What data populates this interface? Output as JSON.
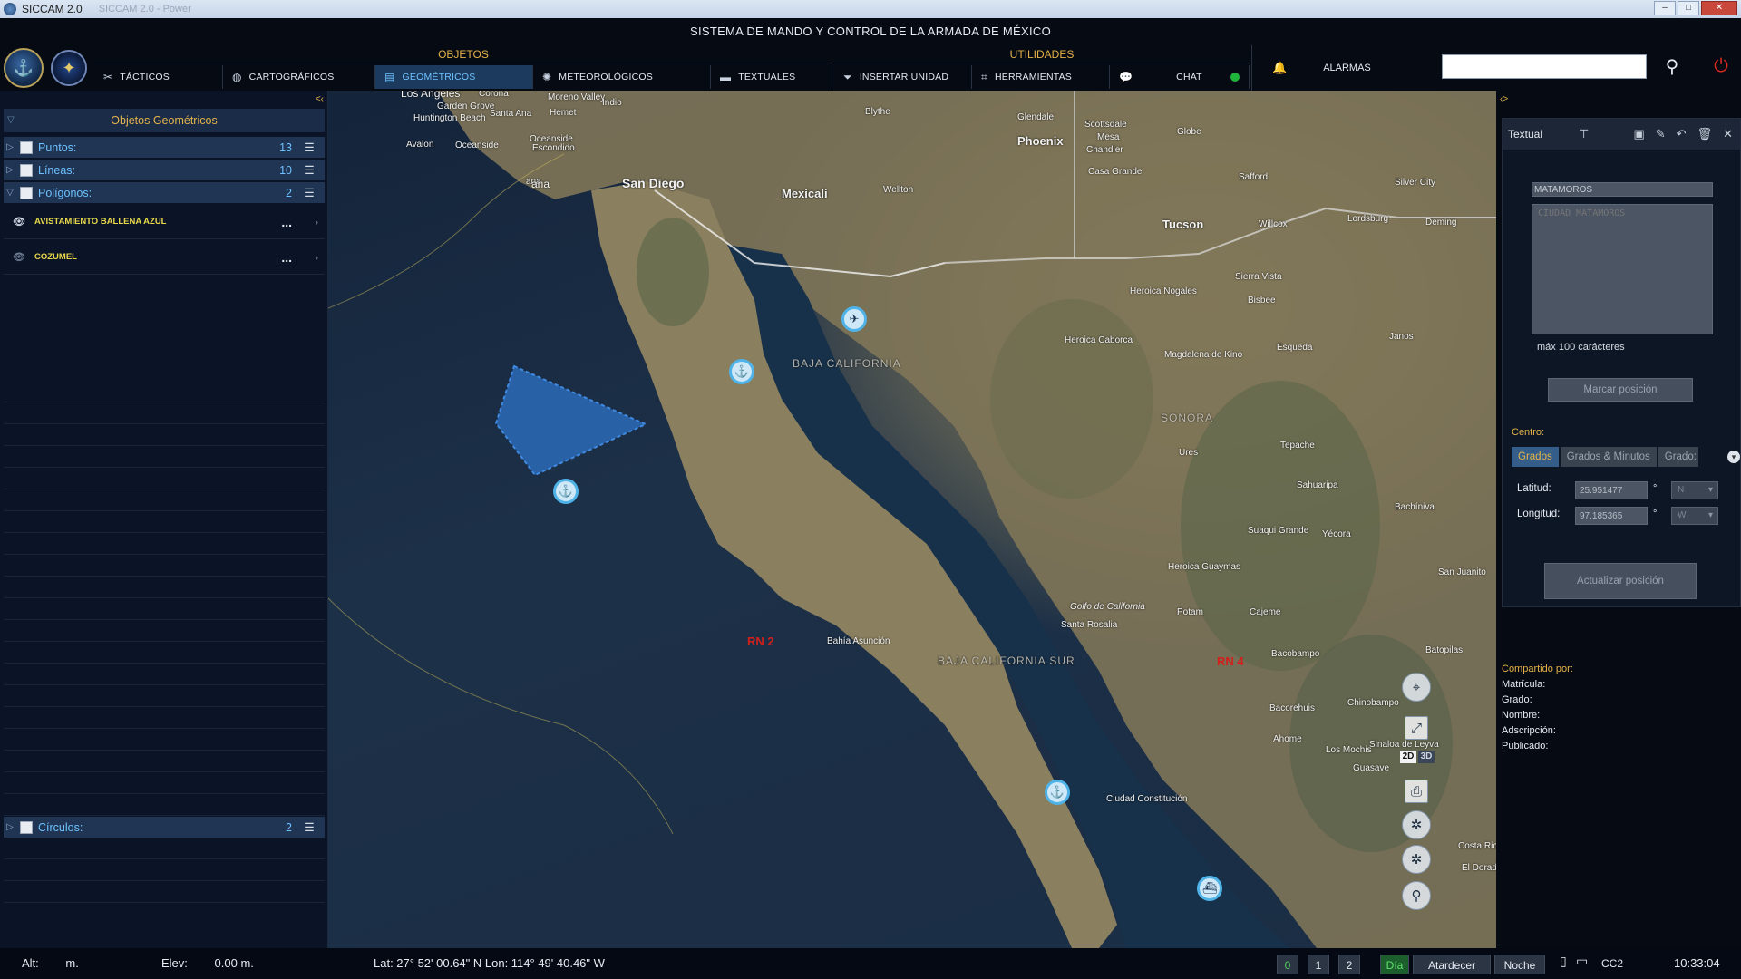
{
  "window": {
    "title": "SICCAM 2.0",
    "blurred_title": "SICCAM 2.0 - Power"
  },
  "header": {
    "system_title": "SISTEMA DE MANDO Y CONTROL DE LA ARMADA DE MÉXICO",
    "group_objetos": "OBJETOS",
    "group_utilidades": "UTILIDADES",
    "menu": {
      "tacticos": "TÁCTICOS",
      "cartograficos": "CARTOGRÁFICOS",
      "geometricos": "GEOMÉTRICOS",
      "meteorologicos": "METEOROLÓGICOS",
      "textuales": "TEXTUALES",
      "insertar_unidad": "INSERTAR UNIDAD",
      "herramientas": "HERRAMIENTAS",
      "chat": "CHAT"
    },
    "alarmas": "ALARMAS",
    "search_value": "",
    "chat_status_color": "#1fb43a",
    "active_color": "#6ec1ff",
    "accent_color": "#e5b24a"
  },
  "left_panel": {
    "collapse_glyph": "<‹",
    "title": "Objetos Geométricos",
    "groups": {
      "puntos": {
        "label": "Puntos:",
        "count": "13"
      },
      "lineas": {
        "label": "Líneas:",
        "count": "10"
      },
      "poligonos": {
        "label": "Polígonos:",
        "count": "2"
      },
      "circulos": {
        "label": "Círculos:",
        "count": "2"
      }
    },
    "polygons": {
      "p1": {
        "name": "AVISTAMIENTO BALLENA AZUL",
        "dots": "..."
      },
      "p2": {
        "name": "COZUMEL",
        "dots": "..."
      }
    }
  },
  "map": {
    "labels": {
      "los_angeles": "Los Angeles",
      "garden_grove": "Garden Grove",
      "corona": "Corona",
      "moreno_valley": "Moreno Valley",
      "huntington": "Huntington Beach",
      "santa_ana": "Santa Ana",
      "hemet": "Hemet",
      "indio": "Indio",
      "avalon": "Avalon",
      "oceanside": "Oceanside",
      "escondido": "Escondido",
      "san_diego": "San Diego",
      "tijuana_frag": "ana",
      "mexicali": "Mexicali",
      "wellton": "Wellton",
      "blythe": "Blythe",
      "glendale": "Glendale",
      "scottsdale": "Scottsdale",
      "phoenix": "Phoenix",
      "mesa": "Mesa",
      "chandler": "Chandler",
      "casa_grande": "Casa Grande",
      "tucson": "Tucson",
      "globe": "Globe",
      "safford": "Safford",
      "willcox": "Willcox",
      "lordsburg": "Lordsburg",
      "deming": "Deming",
      "silver_city": "Silver City",
      "heroica_nogales": "Heroica Nogales",
      "sierra_vista": "Sierra Vista",
      "bisbee": "Bisbee",
      "heroica_caborca": "Heroica Caborca",
      "magdalena": "Magdalena de Kino",
      "esqueda": "Esqueda",
      "janos": "Janos",
      "sonora": "SONORA",
      "baja_california": "BAJA CALIFORNIA",
      "ures": "Ures",
      "tepache": "Tepache",
      "sahuaripa": "Sahuaripa",
      "suaqui_grande": "Suaqui Grande",
      "heroica_guaymas": "Heroica Guaymas",
      "potam": "Potam",
      "cajeme": "Cajeme",
      "golfo": "Golfo de California",
      "santa_rosalia": "Santa Rosalia",
      "bahia_asuncion": "Bahía Asunción",
      "baja_sur": "BAJA CALIFORNIA SUR",
      "bacobampo": "Bacobampo",
      "batopilas": "Batopilas",
      "chinobampo": "Chinobampo",
      "bacorehuis": "Bacorehuis",
      "ahome": "Ahome",
      "los_mochis": "Los Mochis",
      "sinaloa": "Sinaloa de Leyva",
      "guasave": "Guasave",
      "ciudad_constitucion": "Ciudad Constitución",
      "costa_rica": "Costa Ric",
      "el_dorado": "El Dorad",
      "yecora": "Yécora",
      "san_juanito": "San Juanito",
      "bachiniva": "Bachíniva",
      "rn2": "RN 2",
      "rn4": "RN 4"
    },
    "dim_2d": "2D",
    "dim_3d": "3D"
  },
  "right_panel": {
    "collapse_glyph": "‹>",
    "editor_type": "Textual",
    "name_value": "MATAMOROS",
    "desc_placeholder": "CIUDAD MATAMOROS",
    "char_hint": "máx 100 carácteres",
    "mark_button": "Marcar posición",
    "center_label": "Centro:",
    "format_tabs": {
      "grados": "Grados",
      "grados_minutos": "Grados & Minutos",
      "grados_trunc": "Grado:"
    },
    "latitude_label": "Latitud:",
    "latitude_value": "25.951477",
    "latitude_hemi": "N",
    "longitude_label": "Longitud:",
    "longitude_value": "97.185365",
    "longitude_hemi": "W",
    "degree_symbol": "°",
    "update_button": "Actualizar posición",
    "shared": {
      "title": "Compartido por:",
      "matricula": "Matrícula:",
      "grado": "Grado:",
      "nombre": "Nombre:",
      "adscripcion": "Adscripción:",
      "publicado": "Publicado:"
    }
  },
  "status": {
    "alt_label": "Alt:",
    "alt_unit": "m.",
    "elev_label": "Elev:",
    "elev_value": "0.00 m.",
    "coords": "Lat: 27° 52' 00.64\" N   Lon: 114° 49' 40.46\" W",
    "layer_0": "0",
    "layer_1": "1",
    "layer_2": "2",
    "dia": "Día",
    "atardecer": "Atardecer",
    "noche": "Noche",
    "cc": "CC2",
    "clock": "10:33:04"
  }
}
